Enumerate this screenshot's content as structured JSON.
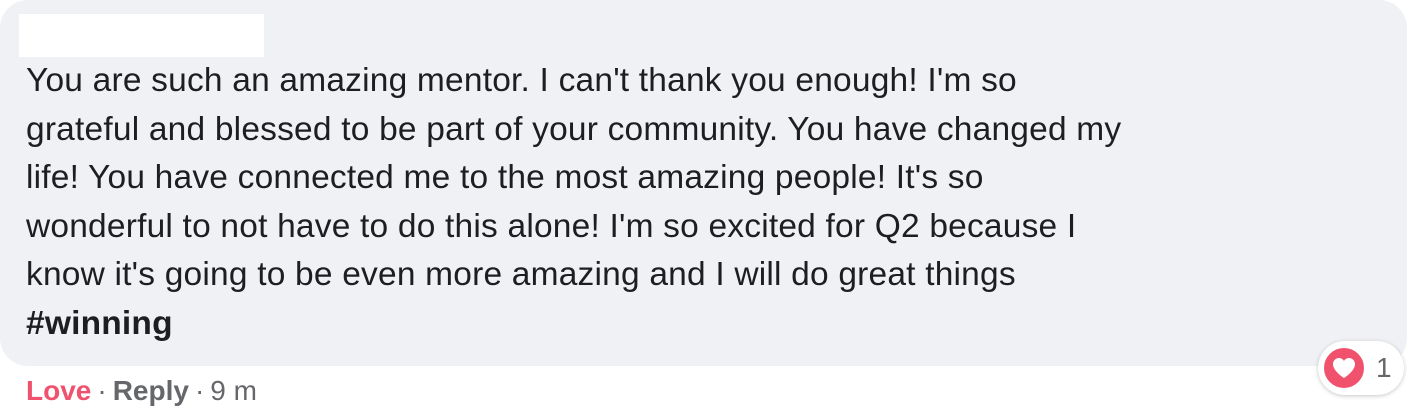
{
  "comment": {
    "text_lines": [
      "You are such an amazing mentor. I can't thank you enough! I'm so",
      "grateful and blessed to be part of your community. You have changed my",
      "life! You have connected me to the most amazing people! It's so",
      "wonderful to not have to do this alone! I'm so excited for Q2 because I",
      "know it's going to be even more amazing and I will do great things"
    ],
    "hashtag": "#winning"
  },
  "reactions": {
    "icon": "heart-icon",
    "count": "1",
    "color": "#f0526e"
  },
  "actions": {
    "love_label": "Love",
    "separator": "·",
    "reply_label": "Reply",
    "timestamp": "9 m"
  },
  "colors": {
    "bubble_background": "#f0f1f5",
    "text": "#1c1e21",
    "meta": "#65676b",
    "love": "#f0526e"
  }
}
